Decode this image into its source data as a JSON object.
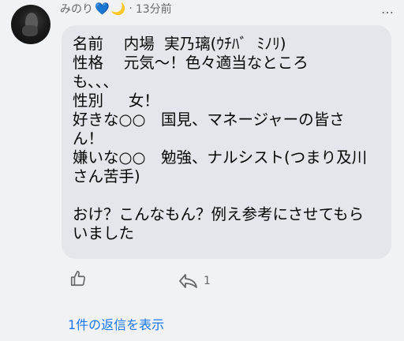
{
  "comment": {
    "author": "みのり",
    "heart_glyph": "💙",
    "moon_glyph": "🌙",
    "separator": "·",
    "time": "13分前",
    "more_glyph": "…",
    "body": "名前　 内場  実乃璃(ｳﾁﾊﾞ  ﾐﾉﾘ)\n性格　 元気〜！色々適当なところ\nも、、、\n性別　  女！\n好きな○○　国見、マネージャーの皆さ\nん！\n嫌いな○○　勉強、ナルシスト(つまり及川\nさん苦手)\n\nおけ？こんなもん？例え参考にさせてもら\nいました"
  },
  "actions": {
    "like_icon": "thumbs-up-icon",
    "reply_icon": "reply-icon",
    "reply_count": "1"
  },
  "replies_link": "1件の返信を表示",
  "colors": {
    "background": "#f0f2f5",
    "bubble": "#e4e6eb",
    "link": "#1877f2",
    "muted": "#65676b"
  }
}
